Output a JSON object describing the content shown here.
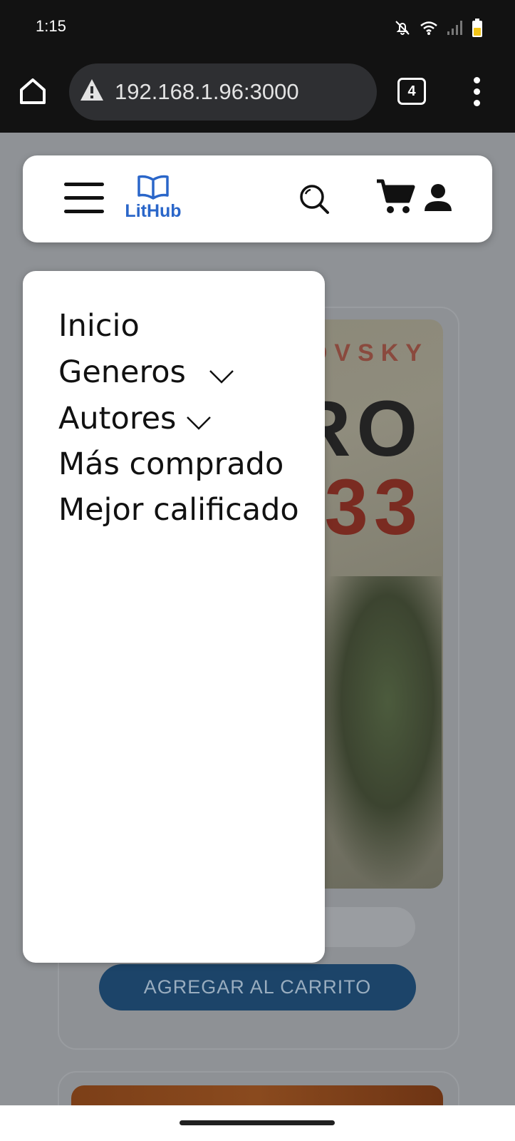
{
  "status_bar": {
    "time": "1:15",
    "icons": [
      "bell-off-icon",
      "wifi-icon",
      "signal-icon",
      "battery-icon"
    ]
  },
  "browser": {
    "url": "192.168.1.96:3000",
    "tab_count": "4",
    "icons": [
      "home-icon",
      "warning-icon",
      "tabs-icon",
      "more-vert-icon"
    ]
  },
  "header": {
    "logo_text": "LitHub",
    "icons": [
      "menu-icon",
      "book-icon",
      "search-icon",
      "cart-icon",
      "user-icon"
    ],
    "accent_color": "#2a66c9"
  },
  "nav_drawer": {
    "items": [
      {
        "label": "Inicio",
        "has_dropdown": false
      },
      {
        "label": "Generos",
        "has_dropdown": true
      },
      {
        "label": "Autores",
        "has_dropdown": true
      },
      {
        "label": "Más comprado",
        "has_dropdown": false
      },
      {
        "label": "Mejor calificado",
        "has_dropdown": false
      }
    ]
  },
  "product": {
    "cover_author_partial": "OVSKY",
    "cover_title_partial_1": "RO",
    "cover_title_partial_2": "33",
    "add_to_cart_label": "AGREGAR AL CARRITO",
    "button_color": "#1c4469"
  }
}
